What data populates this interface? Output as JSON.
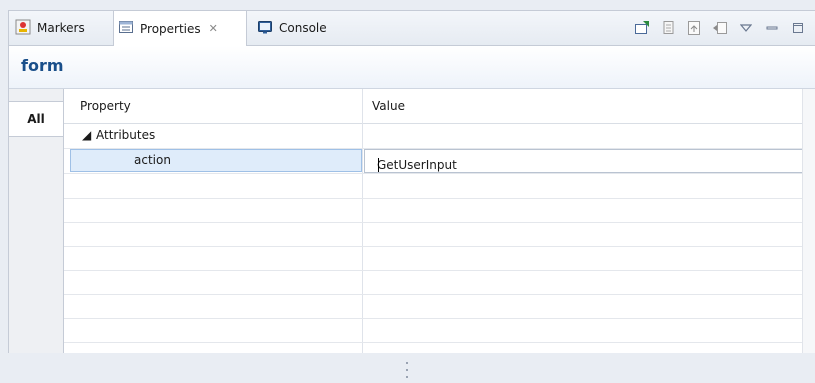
{
  "tabs": [
    {
      "label": "Markers",
      "icon": "markers-icon"
    },
    {
      "label": "Properties",
      "icon": "properties-icon",
      "active": true
    },
    {
      "label": "Console",
      "icon": "console-icon"
    }
  ],
  "tab_close_glyph": "✕",
  "toolbar": {
    "icons": [
      "pin-icon",
      "copy-icon",
      "restore-default-icon",
      "advanced-icon",
      "view-menu-icon",
      "minimize-icon",
      "maximize-icon"
    ]
  },
  "form": {
    "title": "form"
  },
  "side_tabs": [
    {
      "label": "All"
    }
  ],
  "table": {
    "columns": [
      "Property",
      "Value"
    ],
    "group": {
      "expander": "◢",
      "label": "Attributes"
    },
    "rows": [
      {
        "key": "action",
        "value": "GetUserInput"
      }
    ]
  },
  "colors": {
    "accent": "#1a4f8a",
    "selection": "#dfecfa",
    "background": "#e9edf3"
  }
}
